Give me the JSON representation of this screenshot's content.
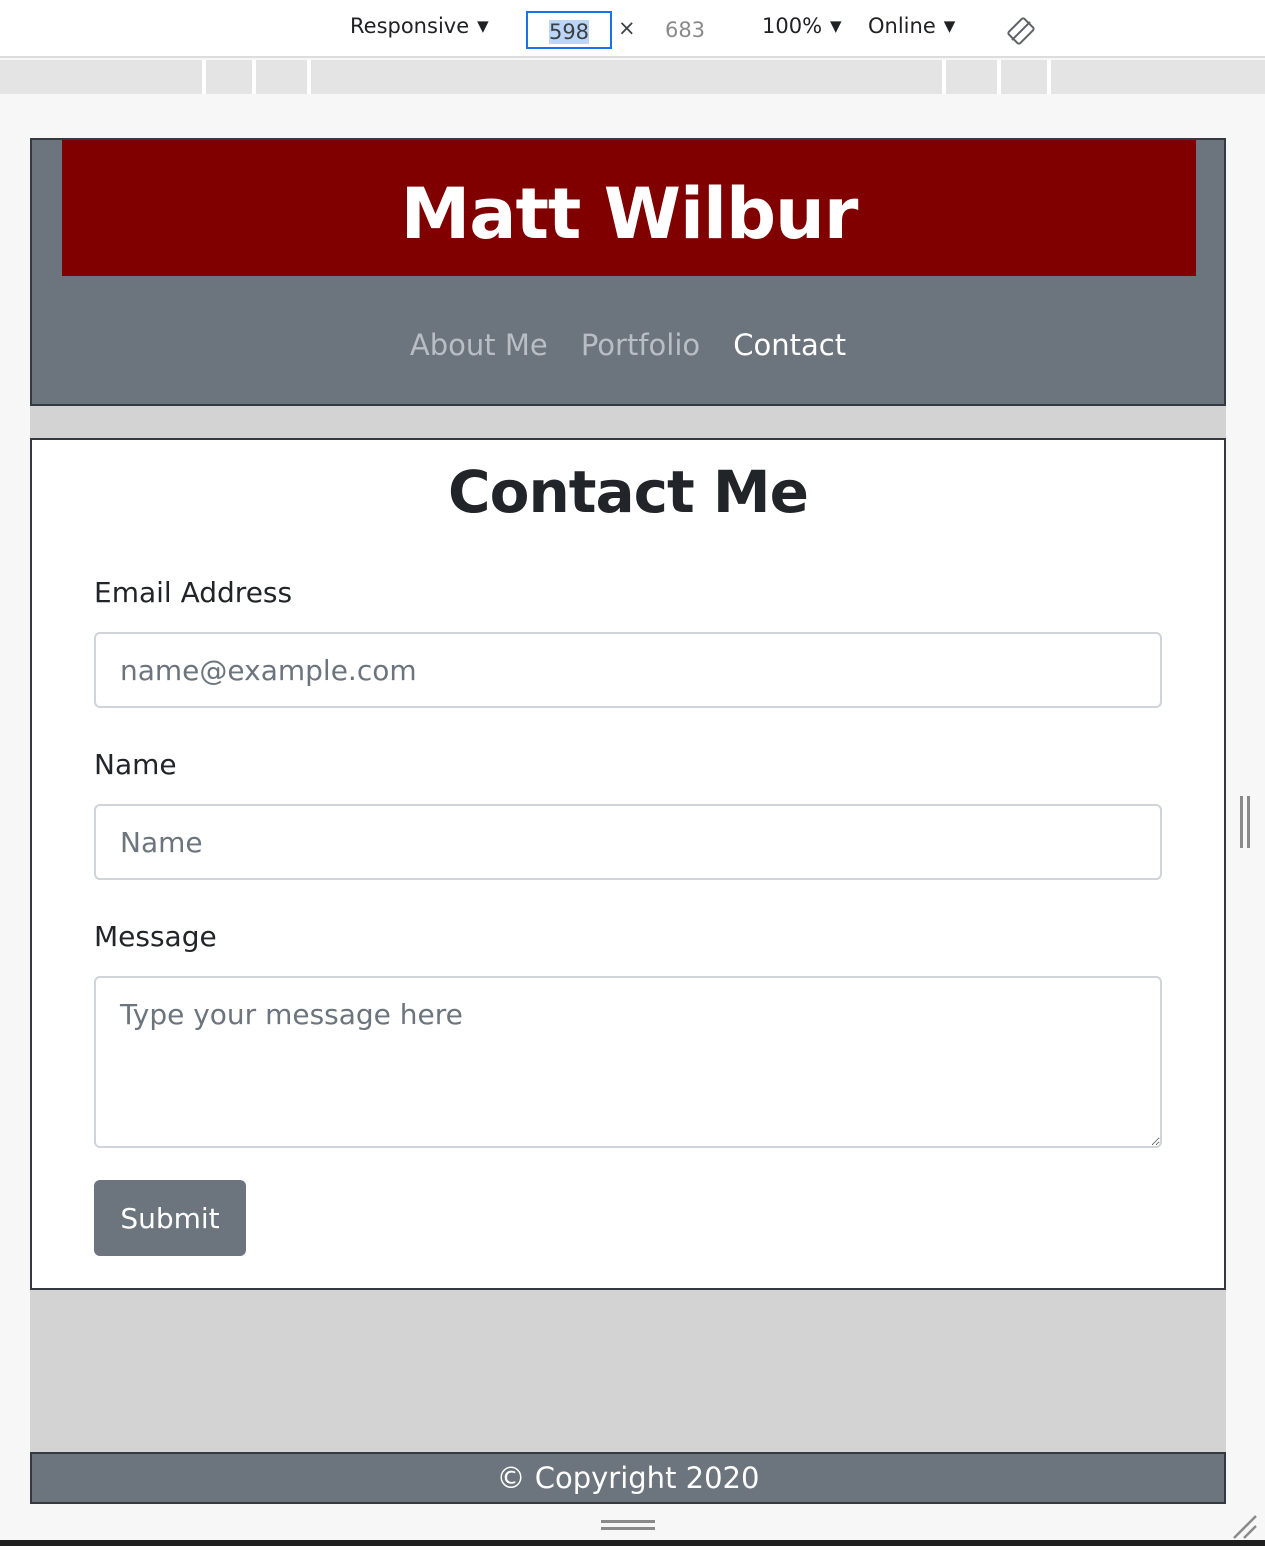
{
  "devtools": {
    "device_label": "Responsive",
    "width_value": "598",
    "times_symbol": "×",
    "height_value": "683",
    "zoom_label": "100%",
    "network_label": "Online",
    "icons": [
      "dropdown-caret",
      "rotate-icon",
      "resize-handle-icon",
      "corner-grip-icon"
    ]
  },
  "site": {
    "brand_title": "Matt Wilbur",
    "brand_color": "#800000",
    "nav": [
      {
        "label": "About Me",
        "active": false
      },
      {
        "label": "Portfolio",
        "active": false
      },
      {
        "label": "Contact",
        "active": true
      }
    ]
  },
  "contact": {
    "heading": "Contact Me",
    "email_label": "Email Address",
    "email_placeholder": "name@example.com",
    "email_value": "",
    "name_label": "Name",
    "name_placeholder": "Name",
    "name_value": "",
    "message_label": "Message",
    "message_placeholder": "Type your message here",
    "message_value": "",
    "submit_label": "Submit"
  },
  "footer": {
    "copyright": "© Copyright 2020"
  }
}
